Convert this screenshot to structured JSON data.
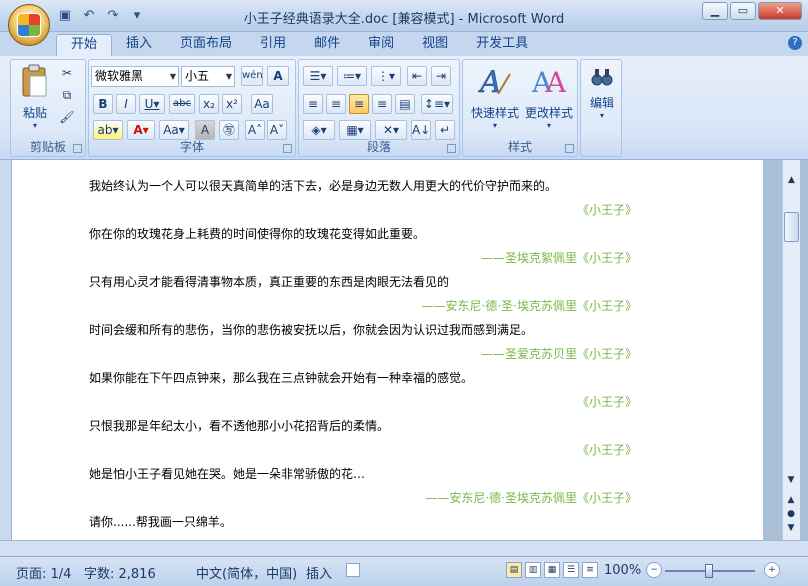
{
  "window": {
    "title": "小王子经典语录大全.doc [兼容模式] - Microsoft Word"
  },
  "quick_access": [
    "save-icon",
    "undo-icon",
    "redo-icon",
    "customize-icon"
  ],
  "tabs": [
    {
      "label": "开始",
      "active": true
    },
    {
      "label": "插入"
    },
    {
      "label": "页面布局"
    },
    {
      "label": "引用"
    },
    {
      "label": "邮件"
    },
    {
      "label": "审阅"
    },
    {
      "label": "视图"
    },
    {
      "label": "开发工具"
    }
  ],
  "ribbon": {
    "clipboard": {
      "group": "剪贴板",
      "paste": "粘贴"
    },
    "font": {
      "group": "字体",
      "family": "微软雅黑",
      "size": "小五"
    },
    "paragraph": {
      "group": "段落"
    },
    "styles": {
      "group": "样式",
      "quick": "快速样式",
      "change": "更改样式"
    },
    "edit": {
      "label": "编辑"
    }
  },
  "document": {
    "lines": [
      {
        "text": "我始终认为一个人可以很天真简单的活下去，必是身边无数人用更大的代价守护而来的。"
      },
      {
        "src": "《小王子》"
      },
      {
        "text": "你在你的玫瑰花身上耗费的时间使得你的玫瑰花变得如此重要。"
      },
      {
        "src": "——圣埃克絮佩里《小王子》"
      },
      {
        "text": "只有用心灵才能看得清事物本质，真正重要的东西是肉眼无法看见的"
      },
      {
        "src": "——安东尼·德·圣·埃克苏佩里《小王子》"
      },
      {
        "text": "时间会缓和所有的悲伤，当你的悲伤被安抚以后，你就会因为认识过我而感到满足。"
      },
      {
        "src": "——圣爱克苏贝里《小王子》"
      },
      {
        "text": "如果你能在下午四点钟来，那么我在三点钟就会开始有一种幸福的感觉。"
      },
      {
        "src": "《小王子》"
      },
      {
        "text": "只恨我那是年纪太小，看不透他那小小花招背后的柔情。"
      },
      {
        "src": "《小王子》"
      },
      {
        "text": "她是怕小王子看见她在哭。她是一朵非常骄傲的花…"
      },
      {
        "src": "——安东尼·德·圣埃克苏佩里《小王子》"
      },
      {
        "text": "请你......帮我画一只绵羊。"
      }
    ]
  },
  "status": {
    "page": "页面: 1/4",
    "words": "字数: 2,816",
    "language": "中文(简体，中国)",
    "mode": "插入",
    "zoom": "100%"
  },
  "colors": {
    "source_text": "#7ab84a",
    "ribbon_bg": "#dbe7f7"
  }
}
